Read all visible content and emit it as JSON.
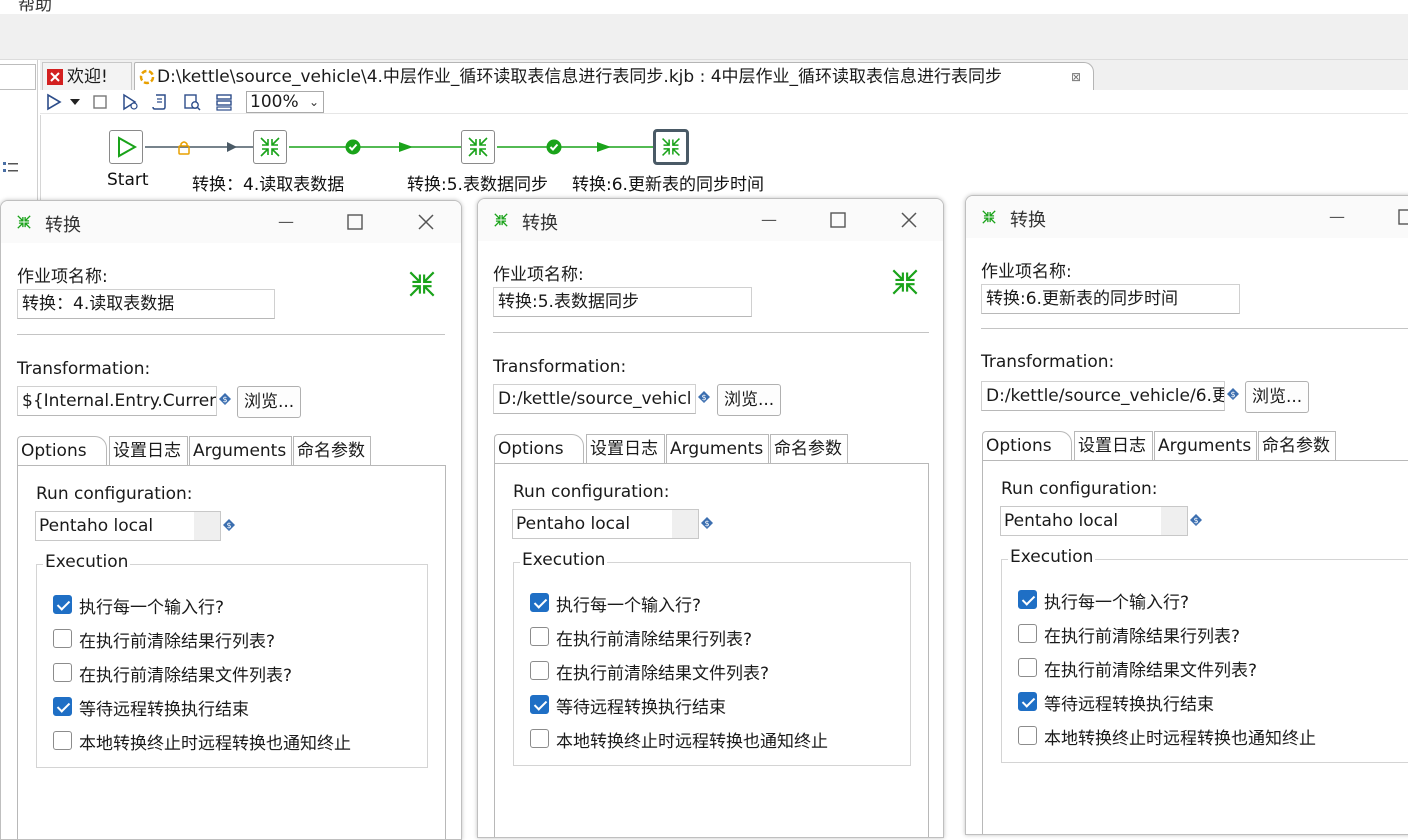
{
  "menu": {
    "help": "帮助"
  },
  "tabs": {
    "welcome": "欢迎!",
    "job": "D:\\kettle\\source_vehicle\\4.中层作业_循环读取表信息进行表同步.kjb : 4中层作业_循环读取表信息进行表同步",
    "close": "⊠"
  },
  "toolbar": {
    "zoom": "100%"
  },
  "canvas": {
    "start": "Start",
    "node1": "转换：4.读取表数据",
    "node2": "转换:5.表数据同步",
    "node3": "转换:6.更新表的同步时间"
  },
  "colors": {
    "accent": "#1f6fc5",
    "hop_green": "#1aa31a",
    "lock_orange": "#e8a000"
  },
  "dialogs": [
    {
      "title": "转换",
      "name_label": "作业项名称:",
      "name_value": "转换：4.读取表数据",
      "trans_label": "Transformation:",
      "trans_value": "${Internal.Entry.Curren",
      "browse": "浏览...",
      "tabs": [
        "Options",
        "设置日志",
        "Arguments",
        "命名参数"
      ],
      "run_config_label": "Run configuration:",
      "run_config_value": "Pentaho local",
      "execution": "Execution",
      "checks": [
        {
          "label": "执行每一个输入行?",
          "checked": true
        },
        {
          "label": "在执行前清除结果行列表?",
          "checked": false
        },
        {
          "label": "在执行前清除结果文件列表?",
          "checked": false
        },
        {
          "label": "等待远程转换执行结束",
          "checked": true
        },
        {
          "label": "本地转换终止时远程转换也通知终止",
          "checked": false
        }
      ]
    },
    {
      "title": "转换",
      "name_label": "作业项名称:",
      "name_value": "转换:5.表数据同步",
      "trans_label": "Transformation:",
      "trans_value": "D:/kettle/source_vehicl",
      "browse": "浏览...",
      "tabs": [
        "Options",
        "设置日志",
        "Arguments",
        "命名参数"
      ],
      "run_config_label": "Run configuration:",
      "run_config_value": "Pentaho local",
      "execution": "Execution",
      "checks": [
        {
          "label": "执行每一个输入行?",
          "checked": true
        },
        {
          "label": "在执行前清除结果行列表?",
          "checked": false
        },
        {
          "label": "在执行前清除结果文件列表?",
          "checked": false
        },
        {
          "label": "等待远程转换执行结束",
          "checked": true
        },
        {
          "label": "本地转换终止时远程转换也通知终止",
          "checked": false
        }
      ]
    },
    {
      "title": "转换",
      "name_label": "作业项名称:",
      "name_value": "转换:6.更新表的同步时间",
      "trans_label": "Transformation:",
      "trans_value": "D:/kettle/source_vehicle/6.更",
      "browse": "浏览...",
      "tabs": [
        "Options",
        "设置日志",
        "Arguments",
        "命名参数"
      ],
      "run_config_label": "Run configuration:",
      "run_config_value": "Pentaho local",
      "execution": "Execution",
      "checks": [
        {
          "label": "执行每一个输入行?",
          "checked": true
        },
        {
          "label": "在执行前清除结果行列表?",
          "checked": false
        },
        {
          "label": "在执行前清除结果文件列表?",
          "checked": false
        },
        {
          "label": "等待远程转换执行结束",
          "checked": true
        },
        {
          "label": "本地转换终止时远程转换也通知终止",
          "checked": false
        }
      ]
    }
  ]
}
